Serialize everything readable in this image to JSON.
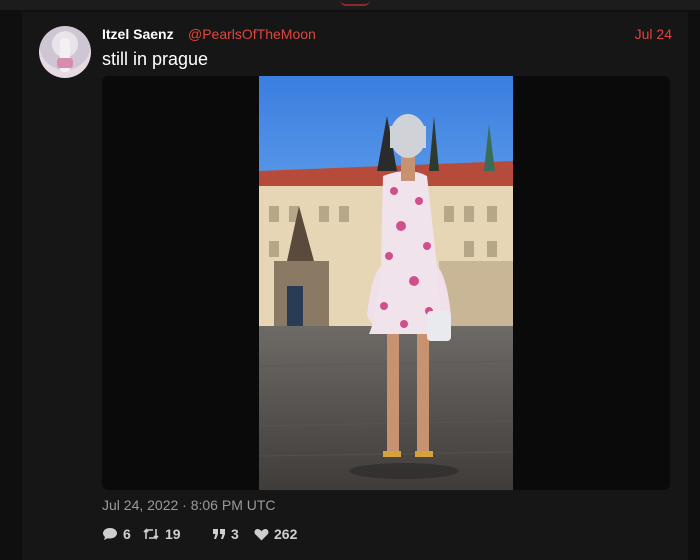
{
  "tweet": {
    "author_name": "Itzel Saenz",
    "handle": "@PearlsOfTheMoon",
    "date": "Jul 24",
    "text": "still in prague",
    "timestamp": "Jul 24, 2022 · 8:06 PM UTC",
    "stats": {
      "replies": "6",
      "retweets": "19",
      "quotes": "3",
      "likes": "262"
    }
  },
  "colors": {
    "accent": "#e0453f",
    "background": "#0f0f0f",
    "card": "#161616",
    "muted_text": "#9a9a9a"
  },
  "icons": {
    "reply": "comment-icon",
    "retweet": "retweet-icon",
    "quote": "quote-icon",
    "like": "heart-icon"
  }
}
